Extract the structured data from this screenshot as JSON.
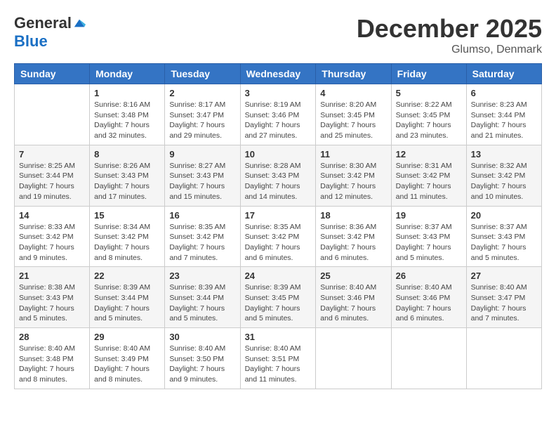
{
  "header": {
    "logo_general": "General",
    "logo_blue": "Blue",
    "month_title": "December 2025",
    "location": "Glumso, Denmark"
  },
  "days_of_week": [
    "Sunday",
    "Monday",
    "Tuesday",
    "Wednesday",
    "Thursday",
    "Friday",
    "Saturday"
  ],
  "weeks": [
    [
      {
        "day": "",
        "info": ""
      },
      {
        "day": "1",
        "info": "Sunrise: 8:16 AM\nSunset: 3:48 PM\nDaylight: 7 hours\nand 32 minutes."
      },
      {
        "day": "2",
        "info": "Sunrise: 8:17 AM\nSunset: 3:47 PM\nDaylight: 7 hours\nand 29 minutes."
      },
      {
        "day": "3",
        "info": "Sunrise: 8:19 AM\nSunset: 3:46 PM\nDaylight: 7 hours\nand 27 minutes."
      },
      {
        "day": "4",
        "info": "Sunrise: 8:20 AM\nSunset: 3:45 PM\nDaylight: 7 hours\nand 25 minutes."
      },
      {
        "day": "5",
        "info": "Sunrise: 8:22 AM\nSunset: 3:45 PM\nDaylight: 7 hours\nand 23 minutes."
      },
      {
        "day": "6",
        "info": "Sunrise: 8:23 AM\nSunset: 3:44 PM\nDaylight: 7 hours\nand 21 minutes."
      }
    ],
    [
      {
        "day": "7",
        "info": "Sunrise: 8:25 AM\nSunset: 3:44 PM\nDaylight: 7 hours\nand 19 minutes."
      },
      {
        "day": "8",
        "info": "Sunrise: 8:26 AM\nSunset: 3:43 PM\nDaylight: 7 hours\nand 17 minutes."
      },
      {
        "day": "9",
        "info": "Sunrise: 8:27 AM\nSunset: 3:43 PM\nDaylight: 7 hours\nand 15 minutes."
      },
      {
        "day": "10",
        "info": "Sunrise: 8:28 AM\nSunset: 3:43 PM\nDaylight: 7 hours\nand 14 minutes."
      },
      {
        "day": "11",
        "info": "Sunrise: 8:30 AM\nSunset: 3:42 PM\nDaylight: 7 hours\nand 12 minutes."
      },
      {
        "day": "12",
        "info": "Sunrise: 8:31 AM\nSunset: 3:42 PM\nDaylight: 7 hours\nand 11 minutes."
      },
      {
        "day": "13",
        "info": "Sunrise: 8:32 AM\nSunset: 3:42 PM\nDaylight: 7 hours\nand 10 minutes."
      }
    ],
    [
      {
        "day": "14",
        "info": "Sunrise: 8:33 AM\nSunset: 3:42 PM\nDaylight: 7 hours\nand 9 minutes."
      },
      {
        "day": "15",
        "info": "Sunrise: 8:34 AM\nSunset: 3:42 PM\nDaylight: 7 hours\nand 8 minutes."
      },
      {
        "day": "16",
        "info": "Sunrise: 8:35 AM\nSunset: 3:42 PM\nDaylight: 7 hours\nand 7 minutes."
      },
      {
        "day": "17",
        "info": "Sunrise: 8:35 AM\nSunset: 3:42 PM\nDaylight: 7 hours\nand 6 minutes."
      },
      {
        "day": "18",
        "info": "Sunrise: 8:36 AM\nSunset: 3:42 PM\nDaylight: 7 hours\nand 6 minutes."
      },
      {
        "day": "19",
        "info": "Sunrise: 8:37 AM\nSunset: 3:43 PM\nDaylight: 7 hours\nand 5 minutes."
      },
      {
        "day": "20",
        "info": "Sunrise: 8:37 AM\nSunset: 3:43 PM\nDaylight: 7 hours\nand 5 minutes."
      }
    ],
    [
      {
        "day": "21",
        "info": "Sunrise: 8:38 AM\nSunset: 3:43 PM\nDaylight: 7 hours\nand 5 minutes."
      },
      {
        "day": "22",
        "info": "Sunrise: 8:39 AM\nSunset: 3:44 PM\nDaylight: 7 hours\nand 5 minutes."
      },
      {
        "day": "23",
        "info": "Sunrise: 8:39 AM\nSunset: 3:44 PM\nDaylight: 7 hours\nand 5 minutes."
      },
      {
        "day": "24",
        "info": "Sunrise: 8:39 AM\nSunset: 3:45 PM\nDaylight: 7 hours\nand 5 minutes."
      },
      {
        "day": "25",
        "info": "Sunrise: 8:40 AM\nSunset: 3:46 PM\nDaylight: 7 hours\nand 6 minutes."
      },
      {
        "day": "26",
        "info": "Sunrise: 8:40 AM\nSunset: 3:46 PM\nDaylight: 7 hours\nand 6 minutes."
      },
      {
        "day": "27",
        "info": "Sunrise: 8:40 AM\nSunset: 3:47 PM\nDaylight: 7 hours\nand 7 minutes."
      }
    ],
    [
      {
        "day": "28",
        "info": "Sunrise: 8:40 AM\nSunset: 3:48 PM\nDaylight: 7 hours\nand 8 minutes."
      },
      {
        "day": "29",
        "info": "Sunrise: 8:40 AM\nSunset: 3:49 PM\nDaylight: 7 hours\nand 8 minutes."
      },
      {
        "day": "30",
        "info": "Sunrise: 8:40 AM\nSunset: 3:50 PM\nDaylight: 7 hours\nand 9 minutes."
      },
      {
        "day": "31",
        "info": "Sunrise: 8:40 AM\nSunset: 3:51 PM\nDaylight: 7 hours\nand 11 minutes."
      },
      {
        "day": "",
        "info": ""
      },
      {
        "day": "",
        "info": ""
      },
      {
        "day": "",
        "info": ""
      }
    ]
  ]
}
